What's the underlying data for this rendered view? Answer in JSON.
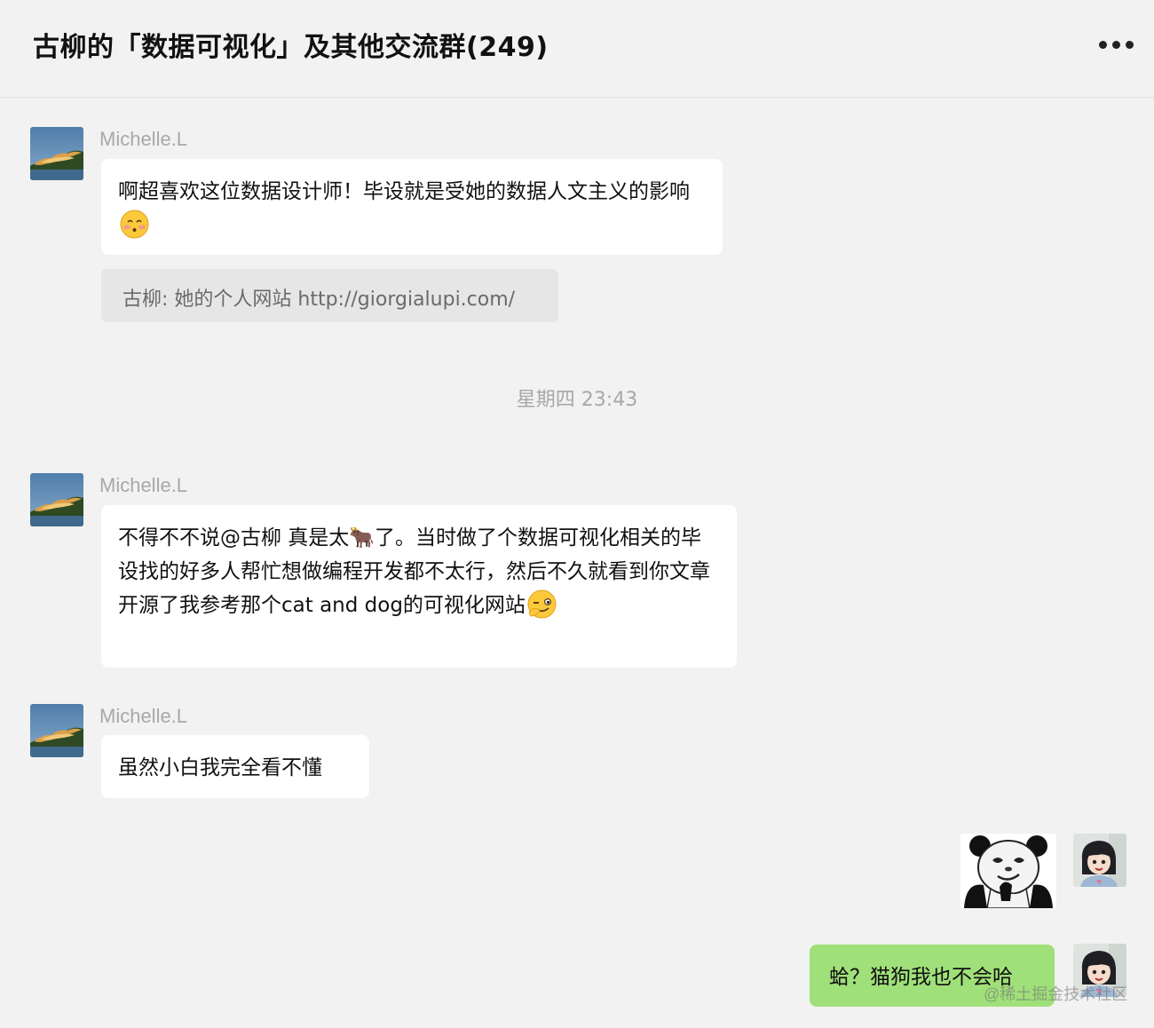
{
  "header": {
    "title": "古柳的「数据可视化」及其他交流群(249)",
    "more_icon": "more-dots-icon"
  },
  "messages": [
    {
      "sender": "Michelle.L",
      "text": "啊超喜欢这位数据设计师！毕设就是受她的数据人文主义的影响",
      "emoji": "smiling-face-emoji"
    },
    {
      "quote": "古柳: 她的个人网站 http://giorgialupi.com/"
    },
    {
      "sender": "Michelle.L",
      "text": "不得不不说@古柳 真是太🐂了。当时做了个数据可视化相关的毕设找的好多人帮忙想做编程开发都不太行，然后不久就看到你文章开源了我参考那个cat and dog的可视化网站",
      "emoji": "winking-face-emoji"
    },
    {
      "sender": "Michelle.L",
      "text": "虽然小白我完全看不懂"
    },
    {
      "sticker": "panda-meme-sticker"
    },
    {
      "text": "蛤？猫狗我也不会哈"
    }
  ],
  "timestamp": "星期四 23:43",
  "watermark": "@稀土掘金技术社区",
  "colors": {
    "background": "#f2f2f2",
    "own_bubble": "#a0e07a",
    "other_bubble": "#ffffff"
  }
}
